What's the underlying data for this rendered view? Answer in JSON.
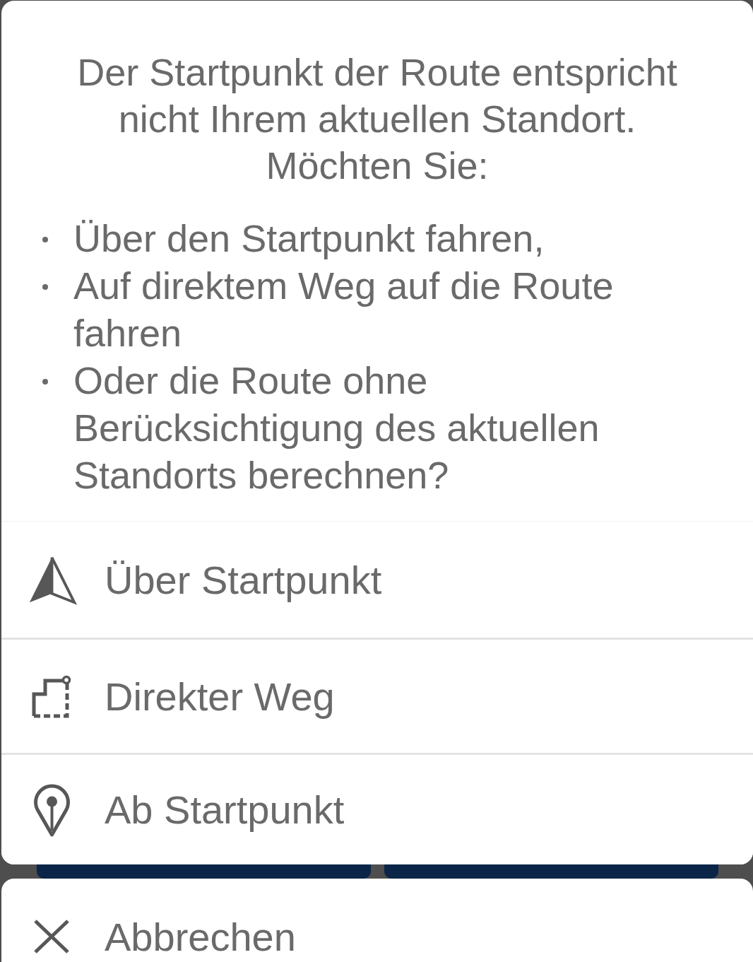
{
  "message": {
    "intro": "Der Startpunkt der Route entspricht nicht Ihrem aktuellen Standort. Möchten Sie:",
    "bullets": [
      "Über den Startpunkt fahren,",
      "Auf direktem Weg auf die Route fahren",
      "Oder die Route ohne Berücksichtigung des aktuellen Standorts berechnen?"
    ]
  },
  "options": [
    {
      "label": "Über Startpunkt"
    },
    {
      "label": "Direkter Weg"
    },
    {
      "label": "Ab Startpunkt"
    }
  ],
  "cancel": {
    "label": "Abbrechen"
  }
}
